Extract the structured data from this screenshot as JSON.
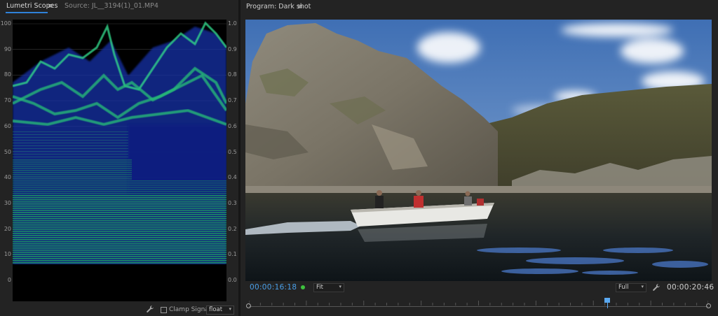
{
  "scopes_panel": {
    "tab_active": "Lumetri Scopes",
    "tab_menu_glyph": "≡",
    "tab_source": "Source: JL__3194(1)_01.MP4",
    "scale_left": [
      "100",
      "90",
      "80",
      "70",
      "60",
      "50",
      "40",
      "30",
      "20",
      "10",
      "0"
    ],
    "scale_right": [
      "1.0",
      "0.9",
      "0.8",
      "0.7",
      "0.6",
      "0.5",
      "0.4",
      "0.3",
      "0.2",
      "0.1",
      "0.0"
    ],
    "footer": {
      "clamp_label": "Clamp Signal",
      "clamp_checked": false,
      "precision_value": "float"
    }
  },
  "program_monitor": {
    "title": "Program: Dark shot",
    "menu_glyph": "≡",
    "current_timecode": "00:00:16:18",
    "duration_timecode": "00:00:20:46",
    "zoom_value": "Fit",
    "resolution_value": "Full",
    "playhead_fraction": 0.78
  },
  "colors": {
    "accent_blue": "#4a9fe8",
    "waveform_green": "#2fd07a",
    "waveform_blue": "#1a3fd0",
    "status_green": "#3ec23e"
  },
  "icons": {
    "wrench": "wrench-icon",
    "chevron": "chevron-down-icon"
  }
}
